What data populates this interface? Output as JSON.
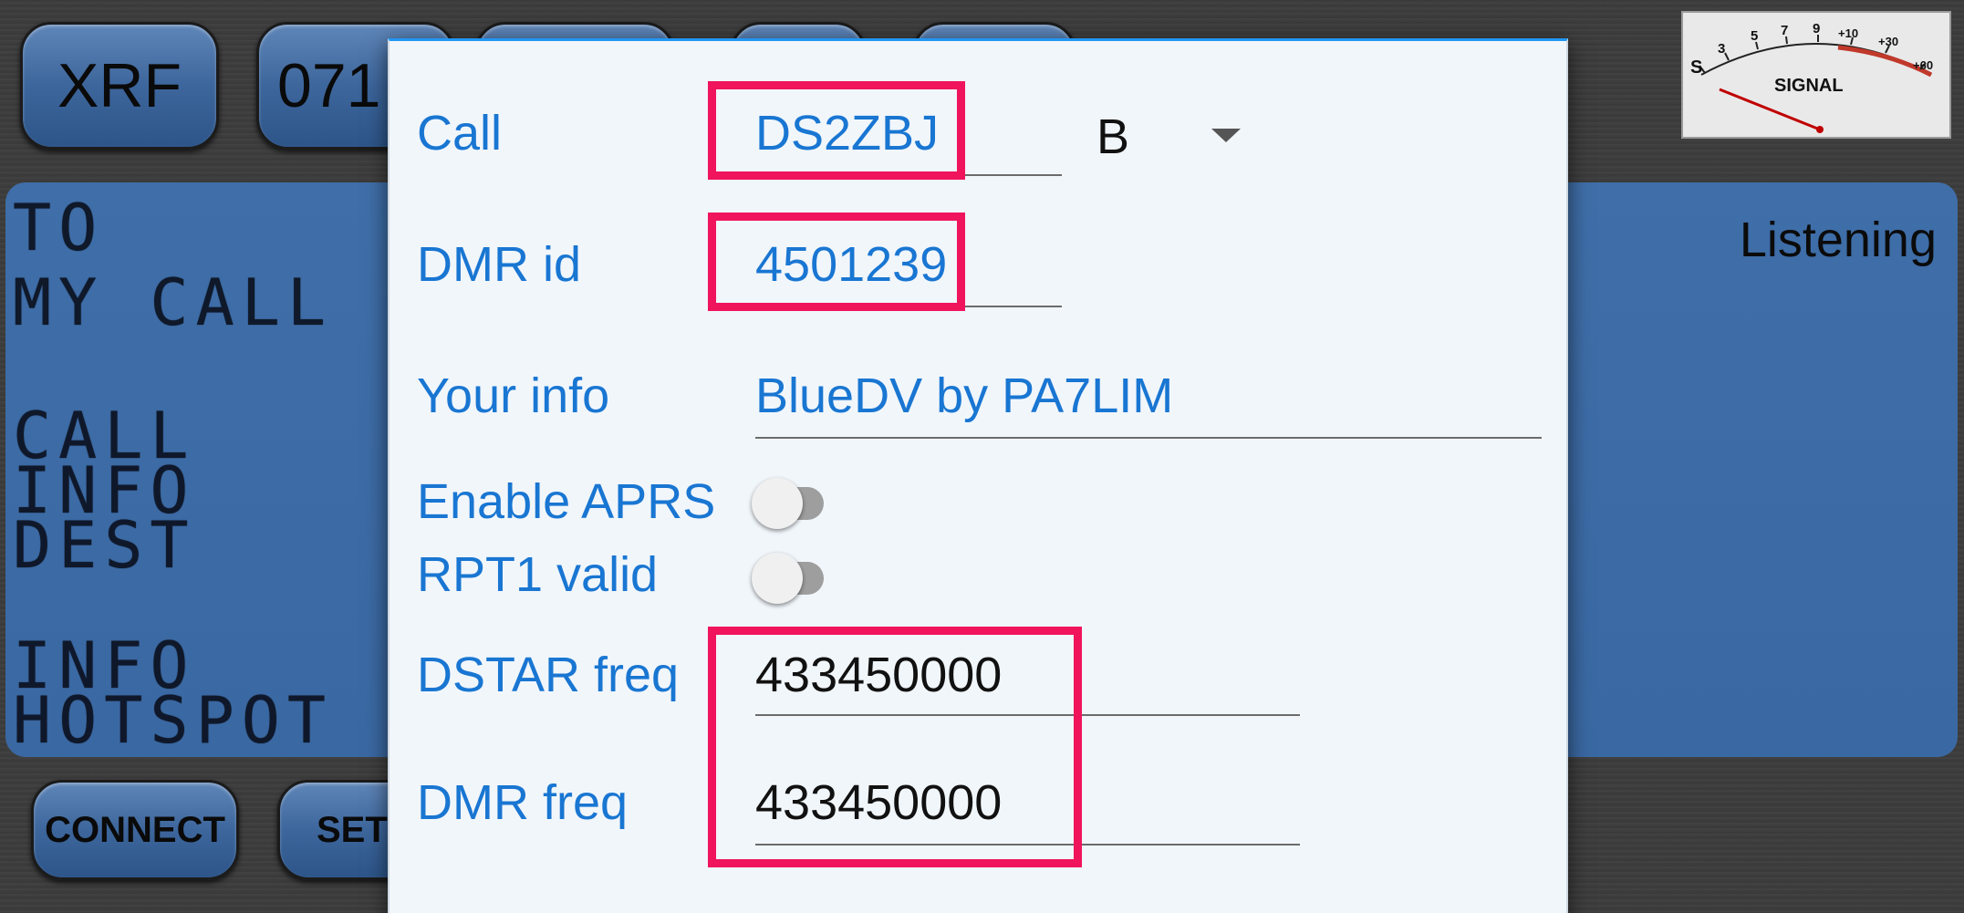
{
  "top_buttons": {
    "reflector_type": "XRF",
    "reflector_number": "071"
  },
  "bottom_buttons": {
    "connect": "CONNECT",
    "settings_partial": "SET"
  },
  "lcd": {
    "to_label": "TO",
    "mycall_label": "MY CALL",
    "call_label": "CALL",
    "info_label": "INFO",
    "dest_label": "DEST",
    "info2_label": "INFO",
    "hotspot_label": "HOTSPOT",
    "status": "Listening"
  },
  "meter": {
    "label": "SIGNAL",
    "scale": [
      "S",
      "3",
      "5",
      "7",
      "9",
      "+10",
      "+30",
      "+60"
    ]
  },
  "dialog": {
    "call_label": "Call",
    "call_value": "DS2ZBJ",
    "module_value": "B",
    "dmr_id_label": "DMR id",
    "dmr_id_value": "4501239",
    "your_info_label": "Your info",
    "your_info_value": "BlueDV by PA7LIM",
    "enable_aprs_label": "Enable APRS",
    "enable_aprs_on": false,
    "rpt1_valid_label": "RPT1 valid",
    "rpt1_valid_on": false,
    "dstar_freq_label": "DSTAR freq",
    "dstar_freq_value": "433450000",
    "dmr_freq_label": "DMR freq",
    "dmr_freq_value": "433450000"
  },
  "colors": {
    "accent": "#1976d2",
    "highlight": "#f0145c",
    "button_blue": "#3d669c"
  }
}
